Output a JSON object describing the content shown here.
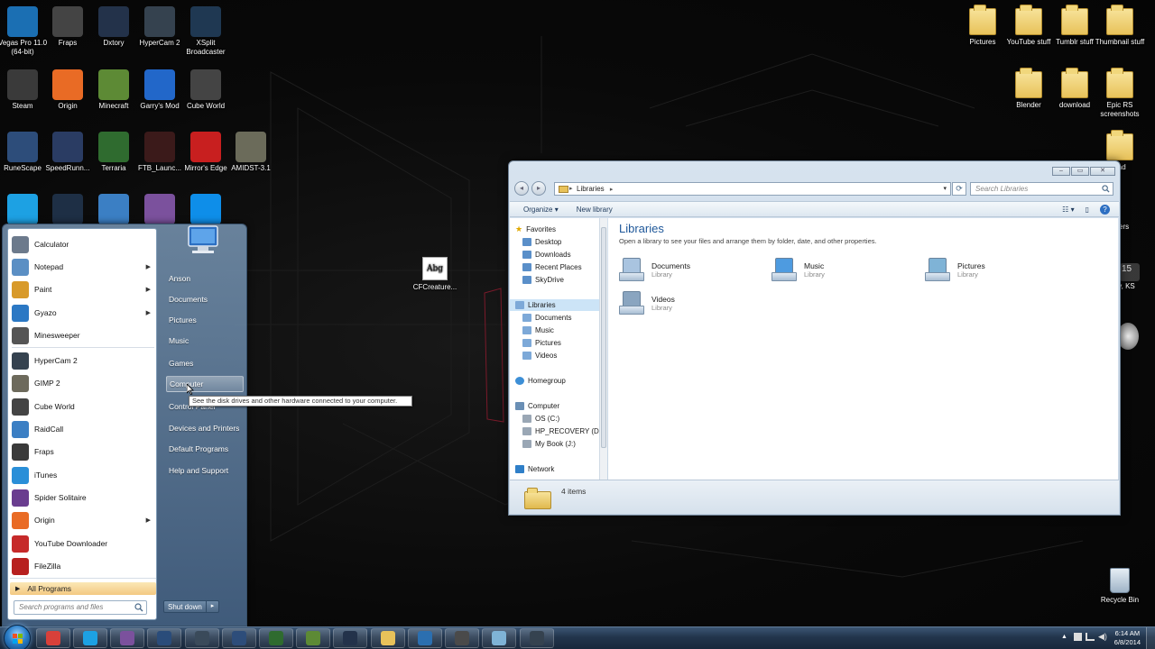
{
  "desktop_icons_left": [
    {
      "label": "Vegas Pro 11.0 (64-bit)",
      "icon": "vegas-pro-icon",
      "color": "#1b6fb3"
    },
    {
      "label": "Fraps",
      "icon": "fraps-icon",
      "color": "#444444"
    },
    {
      "label": "Dxtory",
      "icon": "dxtory-icon",
      "color": "#23324a"
    },
    {
      "label": "HyperCam 2",
      "icon": "hypercam-icon",
      "color": "#35424f"
    },
    {
      "label": "XSplit Broadcaster",
      "icon": "xsplit-icon",
      "color": "#1f3852"
    },
    {
      "label": "Steam",
      "icon": "steam-icon",
      "color": "#3a3a3a"
    },
    {
      "label": "Origin",
      "icon": "origin-icon",
      "color": "#e96b25"
    },
    {
      "label": "Minecraft",
      "icon": "minecraft-icon",
      "color": "#5d8a35"
    },
    {
      "label": "Garry's Mod",
      "icon": "garrys-mod-icon",
      "color": "#2267c9"
    },
    {
      "label": "Cube World",
      "icon": "cube-world-icon",
      "color": "#444444"
    },
    {
      "label": "RuneScape",
      "icon": "runescape-icon",
      "color": "#2d4d7a"
    },
    {
      "label": "SpeedRunn...",
      "icon": "speedrunners-icon",
      "color": "#2a3c63"
    },
    {
      "label": "Terraria",
      "icon": "terraria-icon",
      "color": "#2f6b2f"
    },
    {
      "label": "FTB_Launc...",
      "icon": "ftb-launcher-icon",
      "color": "#3b1a1a"
    },
    {
      "label": "Mirror's Edge",
      "icon": "mirrors-edge-icon",
      "color": "#c81f1f"
    },
    {
      "label": "AMIDST-3.1",
      "icon": "amidst-icon",
      "color": "#6b6b5a"
    },
    {
      "label": "",
      "icon": "skype-icon",
      "color": "#1da1e3"
    },
    {
      "label": "",
      "icon": "teamspeak-icon",
      "color": "#1e2f45"
    },
    {
      "label": "",
      "icon": "raidcall-icon",
      "color": "#3b7fc4"
    },
    {
      "label": "",
      "icon": "viber-icon",
      "color": "#7b519d"
    },
    {
      "label": "",
      "icon": "teamviewer-icon",
      "color": "#0e8ee9"
    }
  ],
  "desktop_icons_right": [
    {
      "label": "Pictures",
      "icon": "folder-icon"
    },
    {
      "label": "YouTube stuff",
      "icon": "folder-icon"
    },
    {
      "label": "Tumblr stuff",
      "icon": "folder-icon"
    },
    {
      "label": "Thumbnail stuff",
      "icon": "folder-icon"
    },
    {
      "label": "Blender",
      "icon": "folder-icon"
    },
    {
      "label": "download",
      "icon": "folder-icon"
    },
    {
      "label": "Epic RS screenshots",
      "icon": "folder-icon"
    },
    {
      "label": "pad",
      "icon": "folder-icon"
    },
    {
      "label": "Recycle Bin",
      "icon": "recycle-bin-icon"
    }
  ],
  "desktop_file": {
    "label": "CFCreature...",
    "thumb_text": "Abg"
  },
  "right_partial_texts": [
    "ers",
    "ty, KS"
  ],
  "start_menu": {
    "programs": [
      {
        "label": "Calculator",
        "icon": "calculator-icon",
        "color": "#6c7a8c",
        "has_arrow": false
      },
      {
        "label": "Notepad",
        "icon": "notepad-icon",
        "color": "#5b8fc4",
        "has_arrow": true
      },
      {
        "label": "Paint",
        "icon": "paint-icon",
        "color": "#d89a2a",
        "has_arrow": true
      },
      {
        "label": "Gyazo",
        "icon": "gyazo-icon",
        "color": "#2b78c4",
        "has_arrow": true
      },
      {
        "label": "Minesweeper",
        "icon": "minesweeper-icon",
        "color": "#555555",
        "has_arrow": false
      },
      {
        "label": "HyperCam 2",
        "icon": "hypercam-icon",
        "color": "#35424f",
        "has_arrow": false
      },
      {
        "label": "GIMP 2",
        "icon": "gimp-icon",
        "color": "#6d6a5c",
        "has_arrow": false
      },
      {
        "label": "Cube World",
        "icon": "cube-world-icon",
        "color": "#444444",
        "has_arrow": false
      },
      {
        "label": "RaidCall",
        "icon": "raidcall-icon",
        "color": "#3b7fc4",
        "has_arrow": false
      },
      {
        "label": "Fraps",
        "icon": "fraps-icon",
        "color": "#3a3a3a",
        "has_arrow": false
      },
      {
        "label": "iTunes",
        "icon": "itunes-icon",
        "color": "#2a8fd8",
        "has_arrow": false
      },
      {
        "label": "Spider Solitaire",
        "icon": "spider-solitaire-icon",
        "color": "#6a3d8f",
        "has_arrow": false
      },
      {
        "label": "Origin",
        "icon": "origin-icon",
        "color": "#e96b25",
        "has_arrow": true
      },
      {
        "label": "YouTube Downloader",
        "icon": "youtube-downloader-icon",
        "color": "#c62a2a",
        "has_arrow": false
      },
      {
        "label": "FileZilla",
        "icon": "filezilla-icon",
        "color": "#b7201f",
        "has_arrow": false
      }
    ],
    "all_programs": "All Programs",
    "search_placeholder": "Search programs and files",
    "right_items": [
      "Anson",
      "Documents",
      "Pictures",
      "Music",
      "Games",
      "Computer",
      "Control Panel",
      "Devices and Printers",
      "Default Programs",
      "Help and Support"
    ],
    "shutdown": "Shut down",
    "tooltip": "See the disk drives and other hardware connected to your computer."
  },
  "explorer": {
    "address_root": "Libraries",
    "search_placeholder": "Search Libraries",
    "toolbar": {
      "organize": "Organize",
      "new_library": "New library"
    },
    "nav": {
      "favorites": "Favorites",
      "favorites_items": [
        "Desktop",
        "Downloads",
        "Recent Places",
        "SkyDrive"
      ],
      "libraries": "Libraries",
      "libraries_items": [
        "Documents",
        "Music",
        "Pictures",
        "Videos"
      ],
      "homegroup": "Homegroup",
      "computer": "Computer",
      "computer_items": [
        "OS (C:)",
        "HP_RECOVERY (D",
        "My Book (J:)"
      ],
      "network": "Network"
    },
    "title": "Libraries",
    "subtitle": "Open a library to see your files and arrange them by folder, date, and other properties.",
    "libraries": [
      {
        "name": "Documents",
        "type": "Library",
        "icon": "documents-library-icon"
      },
      {
        "name": "Music",
        "type": "Library",
        "icon": "music-library-icon"
      },
      {
        "name": "Pictures",
        "type": "Library",
        "icon": "pictures-library-icon"
      },
      {
        "name": "Videos",
        "type": "Library",
        "icon": "videos-library-icon"
      }
    ],
    "status": "4 items"
  },
  "taskbar": {
    "apps": [
      {
        "icon": "chrome-icon",
        "color": "#d8403a"
      },
      {
        "icon": "skype-icon",
        "color": "#1da1e3"
      },
      {
        "icon": "viber-icon",
        "color": "#7b519d"
      },
      {
        "icon": "teamspeak-icon",
        "color": "#2a4c7a"
      },
      {
        "icon": "steam-icon",
        "color": "#3a4a5a"
      },
      {
        "icon": "runescape-icon",
        "color": "#2d4d7a"
      },
      {
        "icon": "terraria-icon",
        "color": "#2f6b2f"
      },
      {
        "icon": "minecraft-icon",
        "color": "#5d8a35"
      },
      {
        "icon": "dxtory-icon",
        "color": "#23324a"
      },
      {
        "icon": "explorer-folder-icon",
        "color": "#e8c25a"
      },
      {
        "icon": "blender-icon",
        "color": "#2b6fb0"
      },
      {
        "icon": "vegas-icon",
        "color": "#4a4a4a"
      },
      {
        "icon": "paint-app-icon",
        "color": "#7fb3d6"
      },
      {
        "icon": "hypercam-icon",
        "color": "#35424f"
      }
    ],
    "time": "6:14 AM",
    "date": "6/8/2014"
  }
}
